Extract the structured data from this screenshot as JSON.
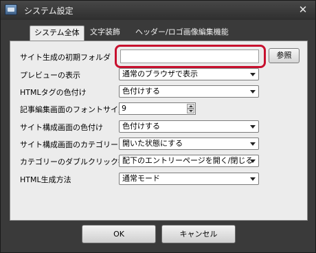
{
  "window": {
    "title": "システム設定"
  },
  "tabs": [
    {
      "label": "システム全体",
      "active": true
    },
    {
      "label": "文字装飾",
      "active": false
    },
    {
      "label": "ヘッダー/ロゴ画像編集機能",
      "active": false
    }
  ],
  "fields": {
    "initial_folder": {
      "label": "サイト生成の初期フォルダ",
      "value": "",
      "browse_label": "参照"
    },
    "preview": {
      "label": "プレビューの表示",
      "value": "通常のブラウザで表示"
    },
    "html_tag_color": {
      "label": "HTMLタグの色付け",
      "value": "色付けする"
    },
    "editor_font_size": {
      "label": "記事編集画面のフォントサイズ",
      "value": "9"
    },
    "site_structure_color": {
      "label": "サイト構成画面の色付け",
      "value": "色付けする"
    },
    "site_structure_category": {
      "label": "サイト構成画面のカテゴリー",
      "value": "開いた状態にする"
    },
    "category_double_click": {
      "label": "カテゴリーのダブルクリック操作",
      "value": "配下のエントリーページを開く/閉じる"
    },
    "html_generation": {
      "label": "HTML生成方法",
      "value": "通常モード"
    }
  },
  "buttons": {
    "ok": "OK",
    "cancel": "キャンセル"
  },
  "colors": {
    "highlight": "#c8102e",
    "panel_bg": "#ececec",
    "chrome_bg": "#3a3a3a"
  }
}
